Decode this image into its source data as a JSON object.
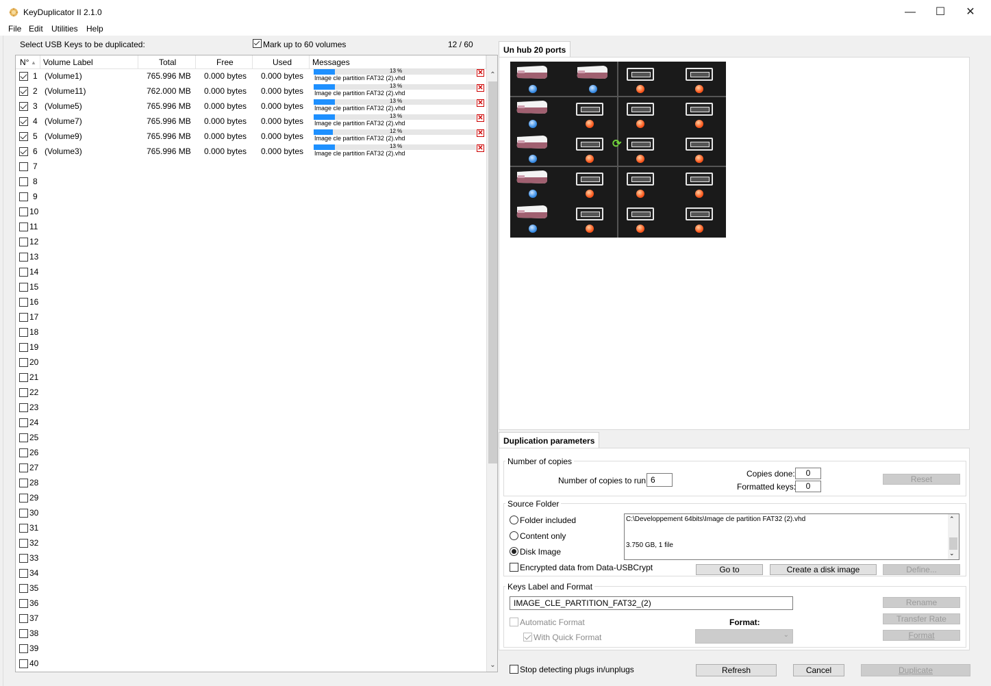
{
  "window": {
    "title": "KeyDuplicator II 2.1.0",
    "minimize": "—",
    "maximize": "☐",
    "close": "✕"
  },
  "menu": [
    "File",
    "Edit",
    "Utilities",
    "Help"
  ],
  "left": {
    "select_label": "Select USB Keys to be duplicated:",
    "mark_label": "Mark up to 60 volumes",
    "counter": "12 / 60",
    "columns": [
      "N°",
      "Volume Label",
      "Total",
      "Free",
      "Used",
      "Messages"
    ],
    "sort_indicator": "▲",
    "rows": [
      {
        "n": "1",
        "label": "(Volume1)",
        "total": "765.996 MB",
        "free": "0.000 bytes",
        "used": "0.000 bytes",
        "pct": "13 %",
        "progress": 0.13,
        "msg": "Image cle partition FAT32 (2).vhd",
        "checked": true
      },
      {
        "n": "2",
        "label": "(Volume11)",
        "total": "762.000 MB",
        "free": "0.000 bytes",
        "used": "0.000 bytes",
        "pct": "13 %",
        "progress": 0.13,
        "msg": "Image cle partition FAT32 (2).vhd",
        "checked": true
      },
      {
        "n": "3",
        "label": "(Volume5)",
        "total": "765.996 MB",
        "free": "0.000 bytes",
        "used": "0.000 bytes",
        "pct": "13 %",
        "progress": 0.13,
        "msg": "Image cle partition FAT32 (2).vhd",
        "checked": true
      },
      {
        "n": "4",
        "label": "(Volume7)",
        "total": "765.996 MB",
        "free": "0.000 bytes",
        "used": "0.000 bytes",
        "pct": "13 %",
        "progress": 0.13,
        "msg": "Image cle partition FAT32 (2).vhd",
        "checked": true
      },
      {
        "n": "5",
        "label": "(Volume9)",
        "total": "765.996 MB",
        "free": "0.000 bytes",
        "used": "0.000 bytes",
        "pct": "12 %",
        "progress": 0.12,
        "msg": "Image cle partition FAT32 (2).vhd",
        "checked": true
      },
      {
        "n": "6",
        "label": "(Volume3)",
        "total": "765.996 MB",
        "free": "0.000 bytes",
        "used": "0.000 bytes",
        "pct": "13 %",
        "progress": 0.13,
        "msg": "Image cle partition FAT32 (2).vhd",
        "checked": true
      }
    ],
    "empty_rows": [
      "7",
      "8",
      "9",
      "10",
      "11",
      "12",
      "13",
      "14",
      "15",
      "16",
      "17",
      "18",
      "19",
      "20",
      "21",
      "22",
      "23",
      "24",
      "25",
      "26",
      "27",
      "28",
      "29",
      "30",
      "31",
      "32",
      "33",
      "34",
      "35",
      "36",
      "37",
      "38",
      "39",
      "40"
    ],
    "msg_close_glyph": "✕"
  },
  "hub": {
    "tab": "Un hub 20 ports",
    "ports": [
      "key",
      "key",
      "port",
      "port",
      "key",
      "port",
      "port",
      "port",
      "key",
      "port",
      "port",
      "port",
      "key",
      "port",
      "port",
      "port",
      "key",
      "port",
      "port",
      "port"
    ],
    "sync_glyph": "⟳"
  },
  "dup": {
    "tab": "Duplication parameters",
    "copies_group": "Number of copies",
    "copies_to_run_label": "Number of copies to run:",
    "copies_to_run": "6",
    "copies_done_label": "Copies done:",
    "copies_done": "0",
    "formatted_label": "Formatted keys:",
    "formatted": "0",
    "reset": "Reset",
    "source_group": "Source Folder",
    "radio_folder": "Folder included",
    "radio_content": "Content only",
    "radio_disk": "Disk Image",
    "encrypted": "Encrypted data from Data-USBCrypt",
    "source_path": "C:\\Developpement 64bits\\Image cle partition FAT32 (2).vhd",
    "source_size": "3.750 GB, 1 file",
    "goto": "Go to",
    "create_image": "Create a disk image",
    "define": "Define...",
    "keys_group": "Keys Label and Format",
    "key_label": "IMAGE_CLE_PARTITION_FAT32_(2)",
    "rename": "Rename",
    "auto_format": "Automatic Format",
    "quick_format": "With Quick Format",
    "format_label": "Format:",
    "transfer_rate": "Transfer Rate",
    "format_btn": "Format"
  },
  "bottom": {
    "stop_detect": "Stop detecting plugs in/unplugs",
    "refresh": "Refresh",
    "cancel": "Cancel",
    "duplicate": "Duplicate"
  }
}
